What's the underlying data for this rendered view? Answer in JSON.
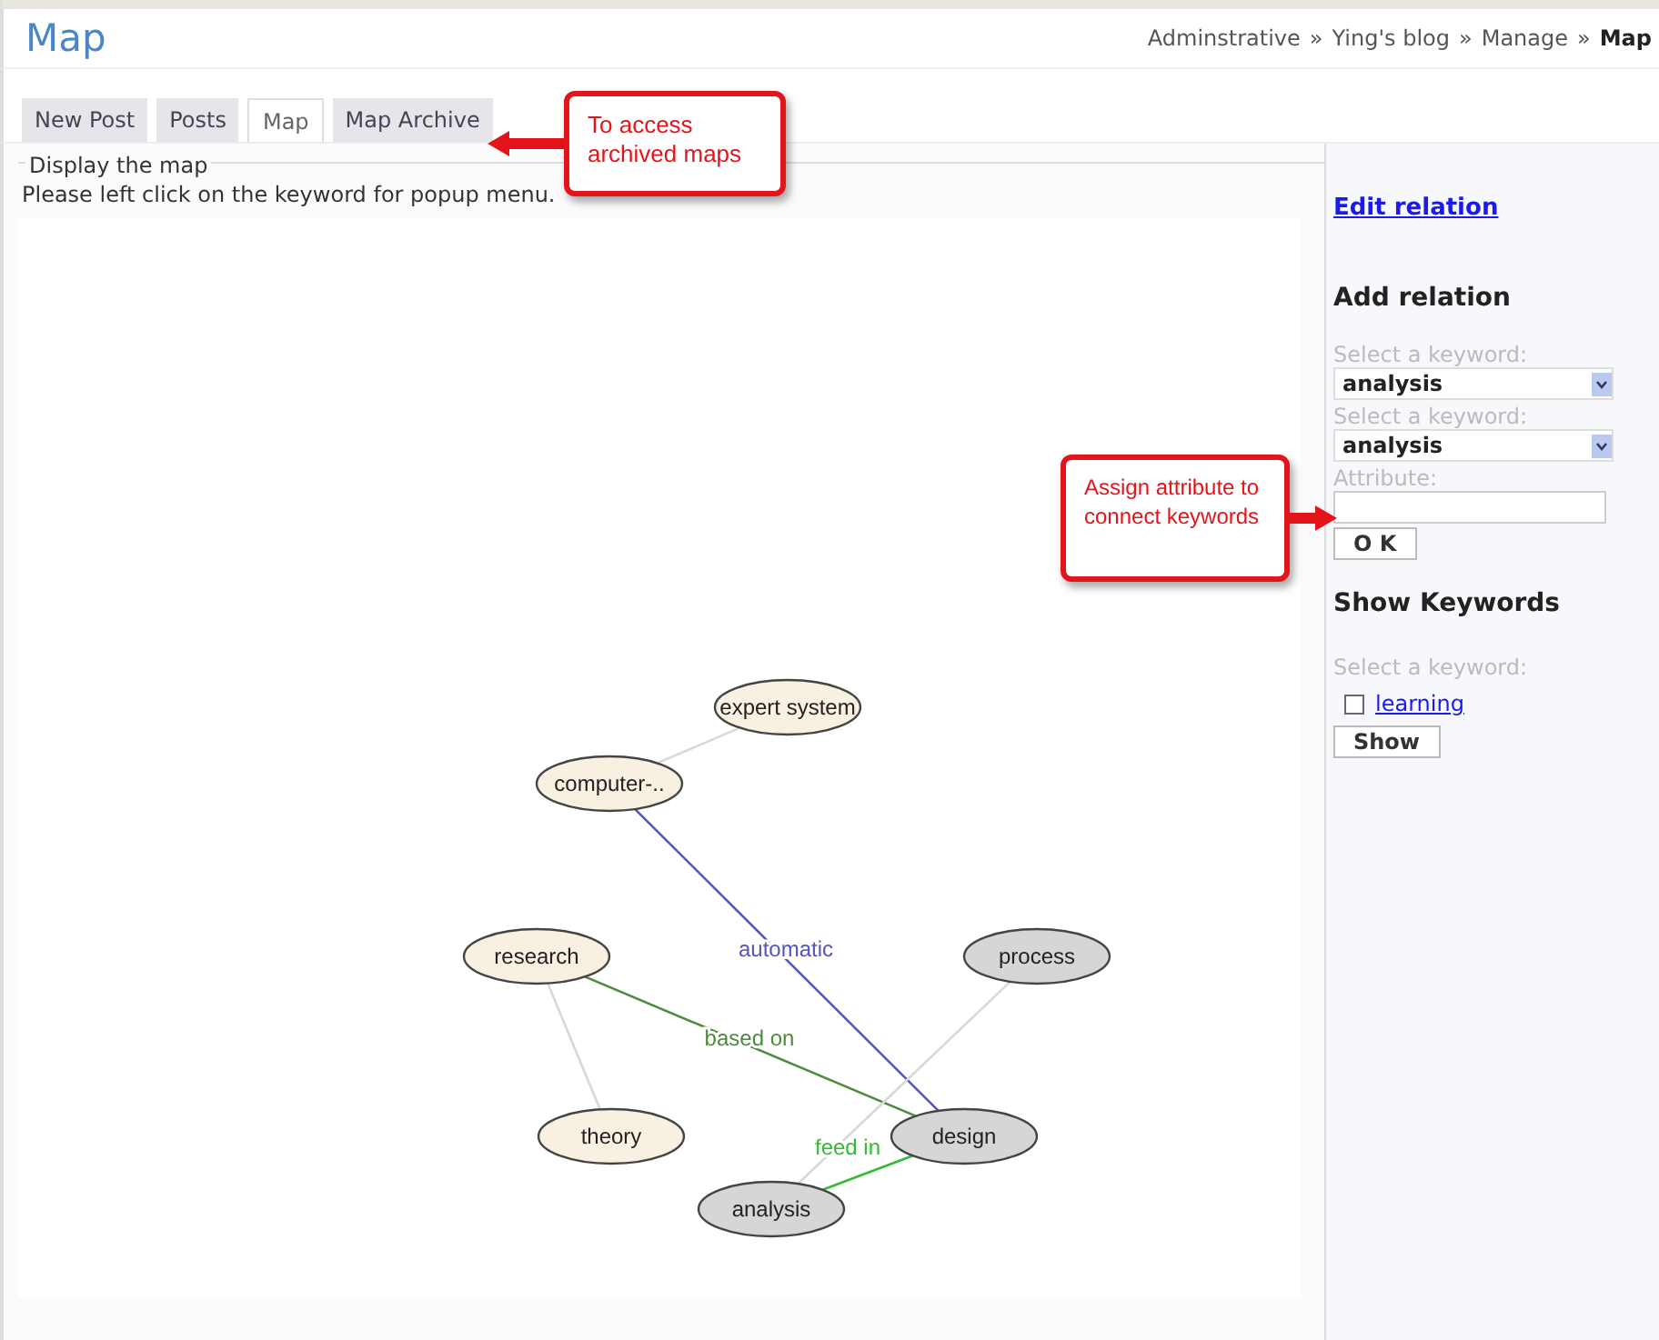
{
  "header": {
    "title": "Map",
    "breadcrumb": [
      {
        "label": "Adminstrative",
        "current": false
      },
      {
        "label": "Ying's blog",
        "current": false
      },
      {
        "label": "Manage",
        "current": false
      },
      {
        "label": "Map",
        "current": true
      }
    ],
    "separator": "»"
  },
  "tabs": [
    {
      "label": "New Post",
      "selected": false
    },
    {
      "label": "Posts",
      "selected": false
    },
    {
      "label": "Map",
      "selected": true
    },
    {
      "label": "Map Archive",
      "selected": false
    }
  ],
  "map_panel": {
    "legend": "Display the map",
    "instruction": "Please left click on the keyword for popup menu.",
    "nodes": [
      {
        "label": "expert system",
        "color": "#f8f0e0"
      },
      {
        "label": "computer-..",
        "color": "#f8f0e0"
      },
      {
        "label": "research",
        "color": "#f8f0e0"
      },
      {
        "label": "process",
        "color": "#d6d6d6"
      },
      {
        "label": "theory",
        "color": "#f8f0e0"
      },
      {
        "label": "design",
        "color": "#d6d6d6"
      },
      {
        "label": "analysis",
        "color": "#d6d6d6"
      }
    ],
    "edges": [
      {
        "color": "#d8d8d8"
      },
      {
        "color": "#5555bb",
        "label": "automatic"
      },
      {
        "color": "#4c8a3c",
        "label": "based on"
      },
      {
        "color": "#d8d8d8"
      },
      {
        "color": "#d8d8d8"
      },
      {
        "color": "#33bb33",
        "label": "feed in"
      }
    ]
  },
  "sidebar": {
    "edit_link": "Edit relation",
    "add_heading": "Add relation",
    "selects": [
      {
        "label": "Select a keyword:",
        "value": "analysis"
      },
      {
        "label": "Select a keyword:",
        "value": "analysis"
      }
    ],
    "attribute_label": "Attribute:",
    "ok_button": "O K",
    "show_heading": "Show Keywords",
    "show_label": "Select a keyword:",
    "keywords": [
      {
        "label": "learning",
        "checked": false
      }
    ],
    "show_button": "Show"
  },
  "callouts": [
    {
      "text": "To access archived maps"
    },
    {
      "text": "Assign attribute to connect keywords"
    }
  ]
}
